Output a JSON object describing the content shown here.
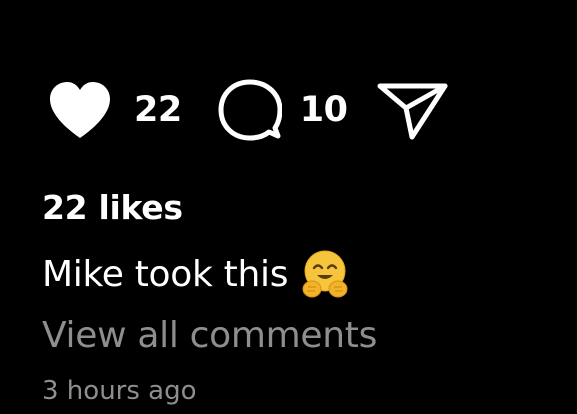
{
  "post": {
    "actions": {
      "like": {
        "icon": "heart-icon",
        "state": "liked",
        "count": "22"
      },
      "comment": {
        "icon": "comment-bubble-icon",
        "count": "10"
      },
      "share": {
        "icon": "send-icon"
      }
    },
    "likes_text": "22 likes",
    "caption": {
      "text": "Mike took this",
      "emoji": "hugging-face-emoji"
    },
    "view_all_comments": "View all comments",
    "timestamp": "3 hours ago"
  },
  "colors": {
    "background": "#000000",
    "primary_text": "#ffffff",
    "secondary_text": "#8e8e8e"
  }
}
